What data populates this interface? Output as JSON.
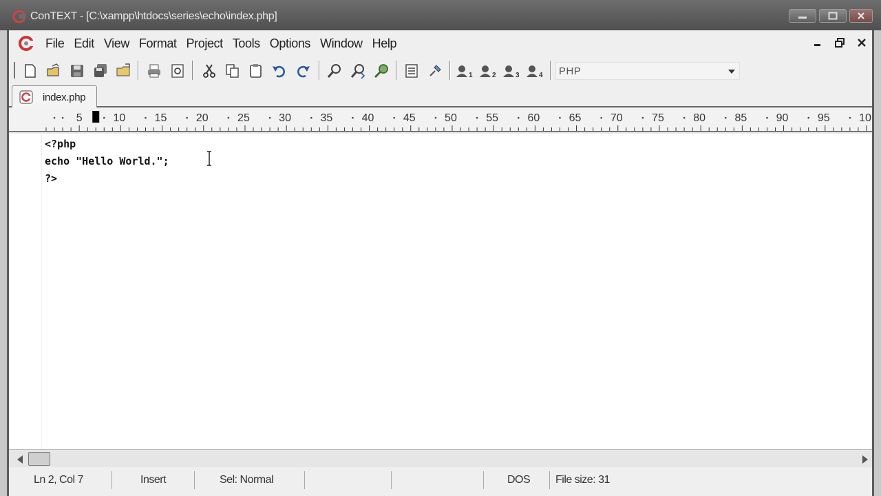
{
  "window": {
    "title": "ConTEXT - [C:\\xampp\\htdocs\\series\\echo\\index.php]",
    "icon": "context-app-icon",
    "controls": [
      "minimize-icon",
      "maximize-icon",
      "close-icon"
    ]
  },
  "menu": {
    "items": [
      "File",
      "Edit",
      "View",
      "Format",
      "Project",
      "Tools",
      "Options",
      "Window",
      "Help"
    ],
    "mdi_controls": [
      "minimize-icon",
      "restore-icon",
      "close-icon"
    ]
  },
  "toolbar": {
    "buttons": [
      "new-file-icon",
      "open-file-icon",
      "save-icon",
      "save-all-icon",
      "open-folder-icon",
      "print-icon",
      "print-preview-icon",
      "cut-icon",
      "copy-icon",
      "paste-icon",
      "undo-icon",
      "redo-icon",
      "find-icon",
      "find-next-icon",
      "replace-icon",
      "list-icon",
      "pin-icon",
      "user-tool-1-icon",
      "user-tool-2-icon",
      "user-tool-3-icon",
      "user-tool-4-icon"
    ],
    "syntax_highlighter": "PHP"
  },
  "tabs": [
    {
      "label": "index.php",
      "icon": "php-file-icon",
      "active": true
    }
  ],
  "ruler": {
    "labels": [
      "5",
      "10",
      "15",
      "20",
      "25",
      "30",
      "35",
      "40",
      "45",
      "50",
      "55",
      "60",
      "65",
      "70",
      "75",
      "80",
      "85",
      "90",
      "95",
      "10"
    ],
    "cursor_column": 7
  },
  "editor": {
    "lines": [
      "<?php",
      "echo \"Hello World.\";",
      "?>"
    ]
  },
  "status": {
    "position": "Ln 2, Col 7",
    "mode": "Insert",
    "selection": "Sel: Normal",
    "line_endings": "DOS",
    "file_size": "File size: 31"
  }
}
